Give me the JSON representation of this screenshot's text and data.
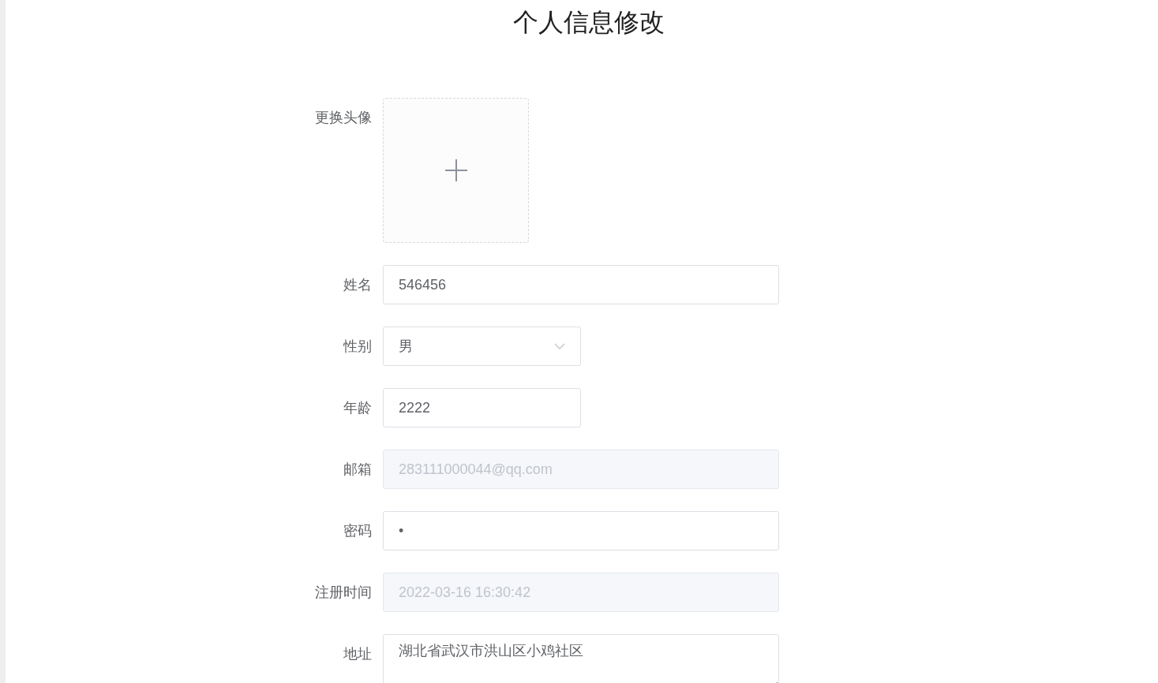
{
  "title": "个人信息修改",
  "fields": [
    {
      "kind": "avatar",
      "label": "更换头像"
    },
    {
      "kind": "text",
      "label": "姓名",
      "value": "546456",
      "wide": true,
      "disabled": false
    },
    {
      "kind": "select",
      "label": "性别",
      "value": "男",
      "wide": false,
      "disabled": false
    },
    {
      "kind": "text",
      "label": "年龄",
      "value": "2222",
      "wide": false,
      "disabled": false
    },
    {
      "kind": "text",
      "label": "邮箱",
      "value": "283111000044@qq.com",
      "wide": true,
      "disabled": true
    },
    {
      "kind": "text",
      "label": "密码",
      "value": "•",
      "wide": true,
      "disabled": false
    },
    {
      "kind": "text",
      "label": "注册时间",
      "value": "2022-03-16 16:30:42",
      "wide": true,
      "disabled": true
    },
    {
      "kind": "textarea",
      "label": "地址",
      "value": "湖北省武汉市洪山区小鸡社区",
      "wide": true,
      "disabled": false
    }
  ]
}
